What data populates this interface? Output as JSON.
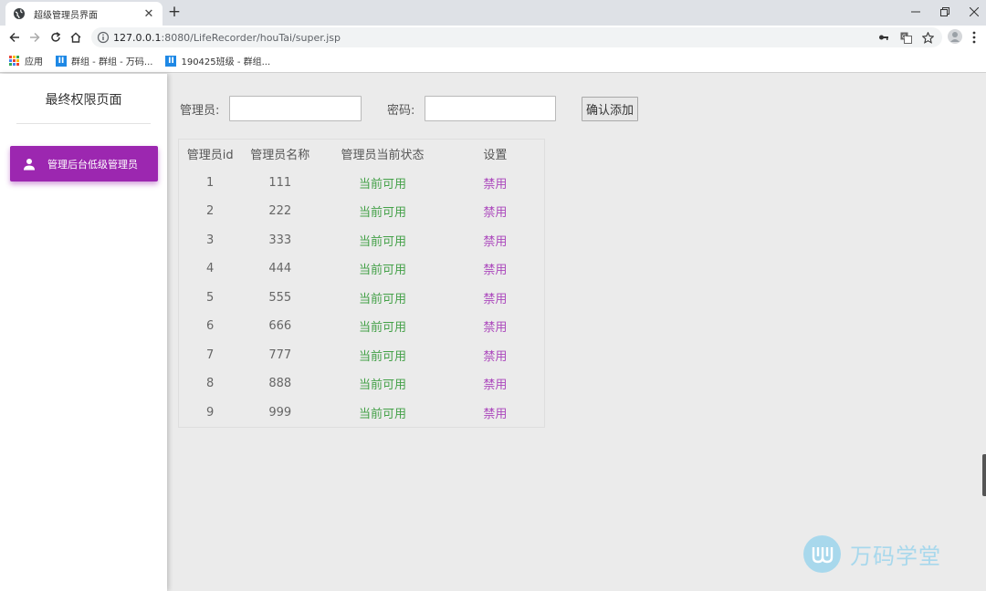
{
  "browser": {
    "tab_title": "超级管理员界面",
    "url_host": "127.0.0.1",
    "url_rest": ":8080/LifeRecorder/houTai/super.jsp",
    "bookmarks": [
      {
        "label": "应用",
        "icon": "apps-grid-icon"
      },
      {
        "label": "群组 - 群组 - 万码...",
        "icon": "wanma-logo-icon"
      },
      {
        "label": "190425班级 - 群组...",
        "icon": "wanma-logo-icon"
      }
    ]
  },
  "sidebar": {
    "title": "最终权限页面",
    "items": [
      {
        "label": "管理后台低级管理员",
        "icon": "person-icon",
        "active": true
      }
    ]
  },
  "form": {
    "admin_label": "管理员:",
    "admin_value": "",
    "password_label": "密码:",
    "password_value": "",
    "confirm_label": "确认添加"
  },
  "table": {
    "headers": [
      "管理员id",
      "管理员名称",
      "管理员当前状态",
      "设置"
    ],
    "rows": [
      {
        "id": "1",
        "name": "111",
        "status": "当前可用",
        "action": "禁用"
      },
      {
        "id": "2",
        "name": "222",
        "status": "当前可用",
        "action": "禁用"
      },
      {
        "id": "3",
        "name": "333",
        "status": "当前可用",
        "action": "禁用"
      },
      {
        "id": "4",
        "name": "444",
        "status": "当前可用",
        "action": "禁用"
      },
      {
        "id": "5",
        "name": "555",
        "status": "当前可用",
        "action": "禁用"
      },
      {
        "id": "6",
        "name": "666",
        "status": "当前可用",
        "action": "禁用"
      },
      {
        "id": "7",
        "name": "777",
        "status": "当前可用",
        "action": "禁用"
      },
      {
        "id": "8",
        "name": "888",
        "status": "当前可用",
        "action": "禁用"
      },
      {
        "id": "9",
        "name": "999",
        "status": "当前可用",
        "action": "禁用"
      }
    ]
  },
  "watermark": {
    "text": "万码学堂"
  },
  "colors": {
    "accent": "#9c27b0",
    "status_ok": "#43a047",
    "action_link": "#ab47bc",
    "watermark": "#a8d8ec"
  }
}
